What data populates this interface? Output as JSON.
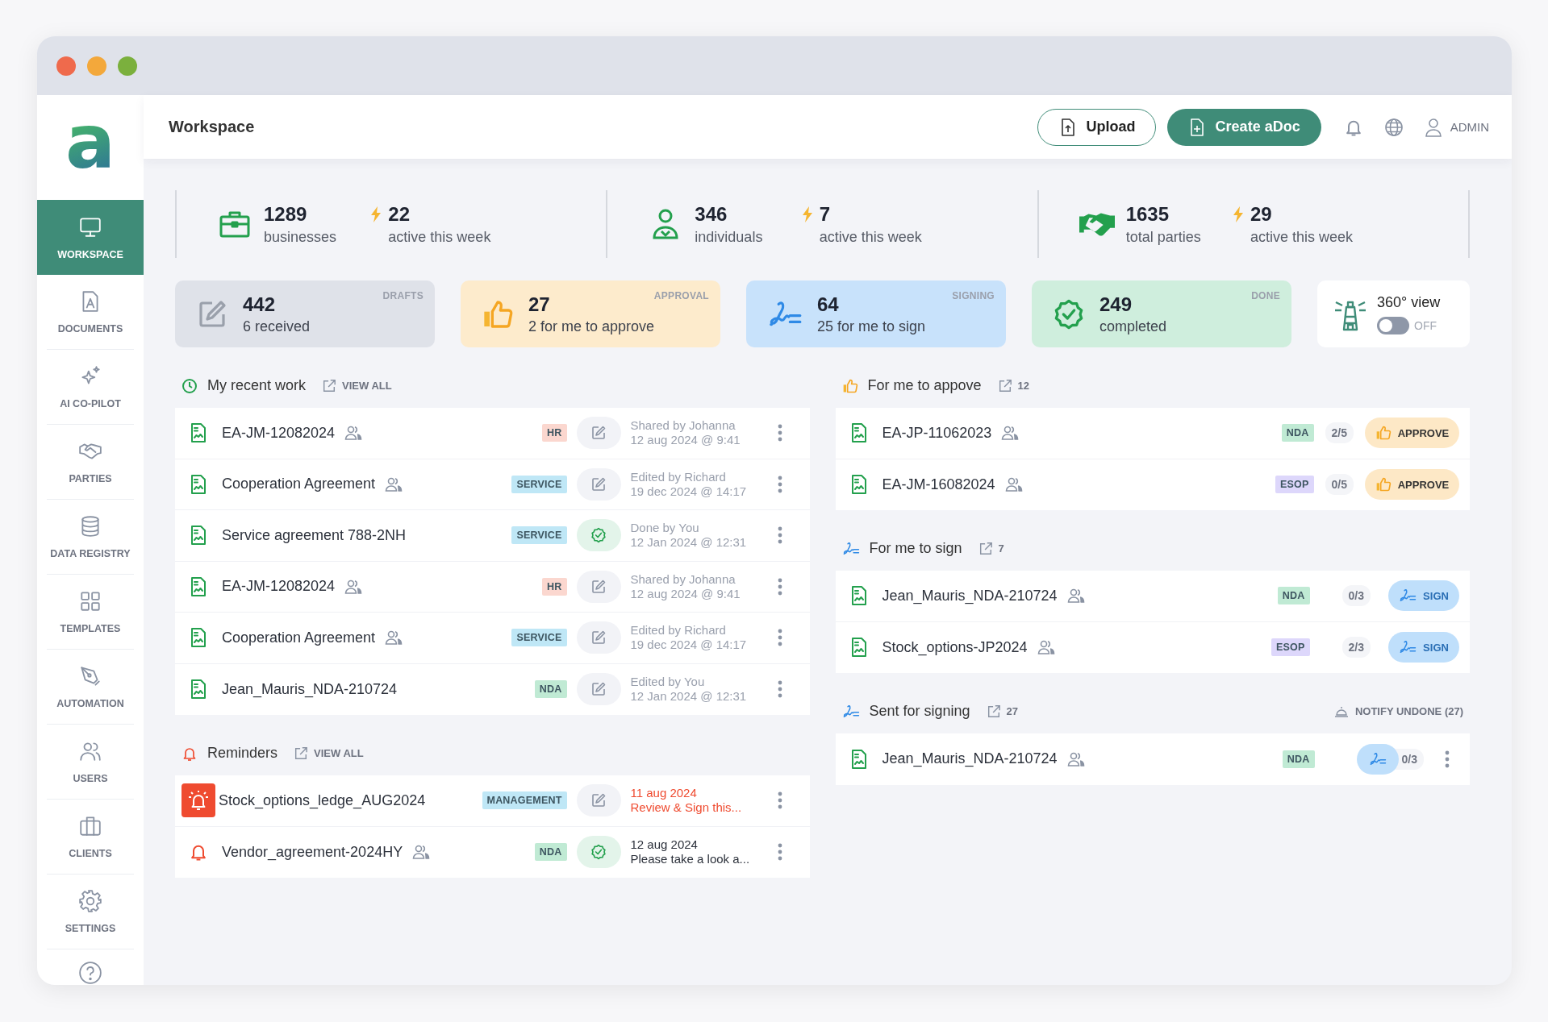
{
  "logo": "a",
  "sidebar": {
    "items": [
      {
        "label": "WORKSPACE",
        "selected": true
      },
      {
        "label": "DOCUMENTS",
        "selected": false
      },
      {
        "label": "AI CO-PILOT",
        "selected": false
      },
      {
        "label": "PARTIES",
        "selected": false
      },
      {
        "label": "DATA REGISTRY",
        "selected": false
      },
      {
        "label": "TEMPLATES",
        "selected": false
      },
      {
        "label": "AUTOMATION",
        "selected": false
      },
      {
        "label": "USERS",
        "selected": false
      },
      {
        "label": "CLIENTS",
        "selected": false
      },
      {
        "label": "SETTINGS",
        "selected": false
      }
    ]
  },
  "header": {
    "title": "Workspace",
    "upload": "Upload",
    "create": "Create aDoc",
    "user": "ADMIN"
  },
  "stats": [
    {
      "value": "1289",
      "label": "businesses",
      "active_value": "22",
      "active_label": "active this week"
    },
    {
      "value": "346",
      "label": "individuals",
      "active_value": "7",
      "active_label": "active this week"
    },
    {
      "value": "1635",
      "label": "total parties",
      "active_value": "29",
      "active_label": "active this week"
    }
  ],
  "cards": [
    {
      "kind": "drafts",
      "tag": "DRAFTS",
      "value": "442",
      "sub": "6 received"
    },
    {
      "kind": "approval",
      "tag": "APPROVAL",
      "value": "27",
      "sub": "2 for me to approve"
    },
    {
      "kind": "signing",
      "tag": "SIGNING",
      "value": "64",
      "sub": "25 for me to sign"
    },
    {
      "kind": "done",
      "tag": "DONE",
      "value": "249",
      "sub": "completed"
    }
  ],
  "view360": {
    "label": "360° view",
    "state_text": "OFF",
    "on": false
  },
  "left": [
    {
      "kind": "recent",
      "title": "My recent work",
      "link": "VIEW ALL",
      "rows": [
        {
          "name": "EA-JM-12082024",
          "shared": true,
          "tag": "HR",
          "color": "#fbd7cf",
          "done": false,
          "by": "Shared by Johanna",
          "when": "12 aug 2024 @ 9:41"
        },
        {
          "name": "Cooperation Agreement",
          "shared": true,
          "tag": "SERVICE",
          "color": "#bfe7f6",
          "done": false,
          "by": "Edited by Richard",
          "when": "19 dec 2024 @ 14:17"
        },
        {
          "name": "Service agreement 788-2NH",
          "shared": false,
          "tag": "SERVICE",
          "color": "#bfe7f6",
          "done": true,
          "by": "Done by You",
          "when": "12 Jan 2024 @ 12:31"
        },
        {
          "name": "EA-JM-12082024",
          "shared": true,
          "tag": "HR",
          "color": "#fbd7cf",
          "done": false,
          "by": "Shared by Johanna",
          "when": "12 aug 2024 @ 9:41"
        },
        {
          "name": "Cooperation Agreement",
          "shared": true,
          "tag": "SERVICE",
          "color": "#bfe7f6",
          "done": false,
          "by": "Edited by Richard",
          "when": "19 dec 2024 @ 14:17"
        },
        {
          "name": "Jean_Mauris_NDA-210724",
          "shared": false,
          "tag": "NDA",
          "color": "#c0ead4",
          "done": false,
          "by": "Edited by You",
          "when": "12 Jan 2024 @ 12:31"
        }
      ]
    },
    {
      "kind": "reminders",
      "title": "Reminders",
      "link": "VIEW ALL",
      "rows": [
        {
          "name": "Stock_options_ledge_AUG2024",
          "urgent": true,
          "shared": false,
          "tag": "MANAGEMENT",
          "color": "#bfe7f6",
          "done": false,
          "by": "11 aug 2024",
          "when": "Review & Sign this...",
          "overdue": true
        },
        {
          "name": "Vendor_agreement-2024HY",
          "urgent": false,
          "shared": true,
          "tag": "NDA",
          "color": "#c0ead4",
          "done": true,
          "by": "12 aug 2024",
          "when": "Please take a look a...",
          "overdue": false
        }
      ]
    }
  ],
  "right": [
    {
      "kind": "approve",
      "title": "For me to appove",
      "count": "12",
      "rows": [
        {
          "name": "EA-JP-11062023",
          "shared": true,
          "tag": "NDA",
          "color": "#c0ead4",
          "progress": "2/5",
          "action": "APPROVE"
        },
        {
          "name": "EA-JM-16082024",
          "shared": true,
          "tag": "ESOP",
          "color": "#ddd7fb",
          "progress": "0/5",
          "action": "APPROVE"
        }
      ]
    },
    {
      "kind": "sign",
      "title": "For me to sign",
      "count": "7",
      "rows": [
        {
          "name": "Jean_Mauris_NDA-210724",
          "shared": true,
          "tag": "NDA",
          "color": "#c0ead4",
          "progress": "0/3",
          "action": "SIGN"
        },
        {
          "name": "Stock_options-JP2024",
          "shared": true,
          "tag": "ESOP",
          "color": "#ddd7fb",
          "progress": "2/3",
          "action": "SIGN"
        }
      ]
    },
    {
      "kind": "sent",
      "title": "Sent for signing",
      "count": "27",
      "notify": "NOTIFY UNDONE (27)",
      "rows": [
        {
          "name": "Jean_Mauris_NDA-210724",
          "shared": true,
          "tag": "NDA",
          "color": "#c0ead4",
          "progress": "0/3"
        }
      ]
    }
  ]
}
